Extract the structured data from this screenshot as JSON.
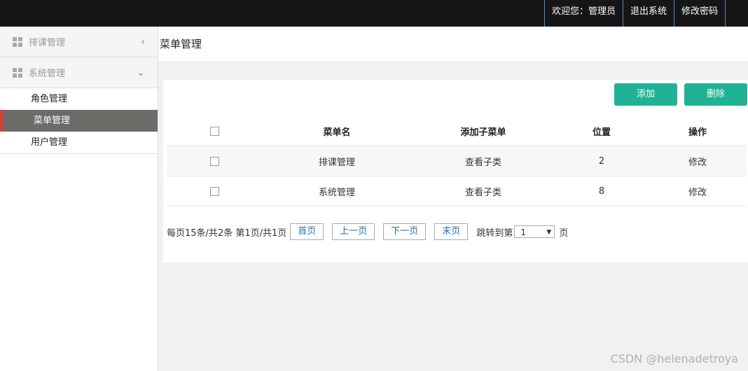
{
  "topnav": {
    "welcome": "欢迎您：管理员",
    "logout": "退出系统",
    "change_password": "修改密码"
  },
  "sidebar": {
    "groups": [
      {
        "label": "排课管理",
        "chevron": "‹",
        "icon": "grid-icon"
      },
      {
        "label": "系统管理",
        "chevron": "⌄",
        "icon": "grid-icon"
      }
    ],
    "items": [
      {
        "label": "角色管理"
      },
      {
        "label": "菜单管理",
        "active": true
      },
      {
        "label": "用户管理"
      }
    ]
  },
  "page": {
    "title": "菜单管理"
  },
  "toolbar": {
    "add_label": "添加",
    "delete_label": "删除"
  },
  "table": {
    "headers": [
      "菜单名",
      "添加子菜单",
      "位置",
      "操作"
    ],
    "rows": [
      {
        "name": "排课管理",
        "sub": "查看子类",
        "position": "2",
        "action": "修改"
      },
      {
        "name": "系统管理",
        "sub": "查看子类",
        "position": "8",
        "action": "修改"
      }
    ]
  },
  "pager": {
    "summary": "每页15条/共2条 第1页/共1页",
    "first": "首页",
    "prev": "上一页",
    "next": "下一页",
    "last": "末页",
    "jump_label": "跳转到第",
    "selected_page": "1",
    "page_suffix": "页"
  },
  "watermark": "CSDN @helenadetroya",
  "colors": {
    "accent": "#1fb294",
    "topbar": "#161616",
    "active_item": "#6d6b68",
    "active_marker": "#e53935"
  }
}
